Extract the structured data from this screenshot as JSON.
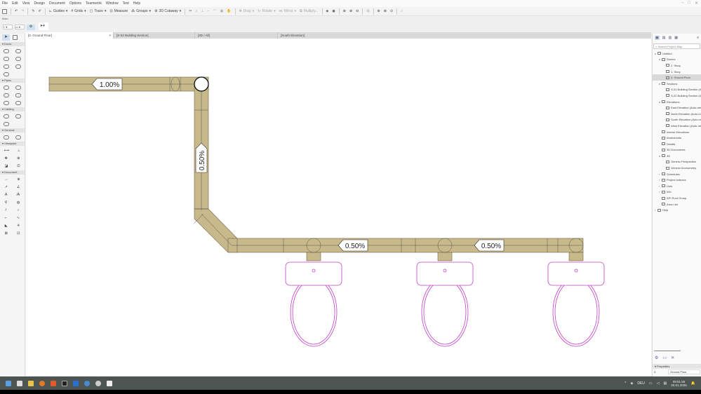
{
  "menu": [
    "File",
    "Edit",
    "View",
    "Design",
    "Document",
    "Options",
    "Teamwork",
    "Window",
    "Test",
    "Help"
  ],
  "toolbar": {
    "guides": "Guides",
    "grids": "Grids",
    "trace": "Trace",
    "measure": "Measure",
    "groups": "Groups",
    "cutaway": "3D Cutaway",
    "drag": "Drag",
    "rotate": "Rotate",
    "mirror": "Mirror",
    "multiply": "Multiply..."
  },
  "infobox": {
    "label": "Main"
  },
  "tabs": [
    "[0. Ground Floor]",
    "[S-02 Building Section]",
    "[3D / All]",
    "[South Elevation]"
  ],
  "toolbox": {
    "groups": [
      "Ducts",
      "Pipes",
      "Cabling",
      "General",
      "Viewpoint",
      "Document"
    ]
  },
  "drawing": {
    "slopes": [
      "1.00%",
      "0.50%",
      "0.50%",
      "0.50%"
    ],
    "colors": {
      "pipe": "#c8b98a",
      "fixture": "#c040c8"
    }
  },
  "navigator": {
    "search_placeholder": "Search Project Map",
    "items": [
      "Untitled",
      "Stories",
      "2. Story",
      "1. Story",
      "0. Ground Floor",
      "Sections",
      "S-01 Building Section (Auto)",
      "S-02 Building Section (Auto)",
      "Elevations",
      "East Elevation (Auto-rebuild)",
      "North Elevation (Auto-rebuild)",
      "South Elevation (Auto-rebuild)",
      "West Elevation (Auto-rebuild)",
      "Interior Elevations",
      "Worksheets",
      "Details",
      "3D Documents",
      "3D",
      "Generic Perspective",
      "Generic Axonometry",
      "Schedules",
      "Project Indexes",
      "Lists",
      "Info",
      "API Root Group",
      "Area List",
      "Help"
    ],
    "properties_label": "Properties",
    "prop_key": "0.",
    "prop_value": "Ground Floor"
  },
  "taskbar": {
    "lang": "DEU",
    "time": "09:51:55",
    "date": "20.01.2025"
  }
}
